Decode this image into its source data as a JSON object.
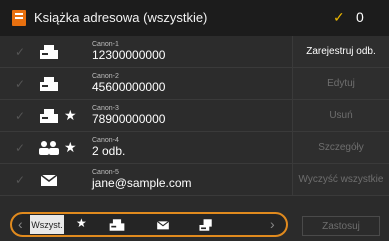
{
  "header": {
    "title": "Książka adresowa (wszystkie)",
    "check_mark": "✓",
    "selected_count": "0"
  },
  "rows": [
    {
      "name": "Canon-1",
      "number": "12300000000",
      "type": "fax",
      "favorite": false
    },
    {
      "name": "Canon-2",
      "number": "45600000000",
      "type": "fax",
      "favorite": false
    },
    {
      "name": "Canon-3",
      "number": "78900000000",
      "type": "fax",
      "favorite": true
    },
    {
      "name": "Canon-4",
      "number": "2 odb.",
      "type": "group",
      "favorite": true
    },
    {
      "name": "Canon-5",
      "number": "jane@sample.com",
      "type": "email",
      "favorite": false
    }
  ],
  "side_buttons": {
    "register": "Zarejestruj odb.",
    "edit": "Edytuj",
    "delete": "Usuń",
    "details": "Szczegóły",
    "clear_all": "Wyczyść wszystkie"
  },
  "filter": {
    "all_label": "Wszyst.",
    "prev": "‹",
    "next": "›"
  },
  "apply_button": "Zastosuj"
}
